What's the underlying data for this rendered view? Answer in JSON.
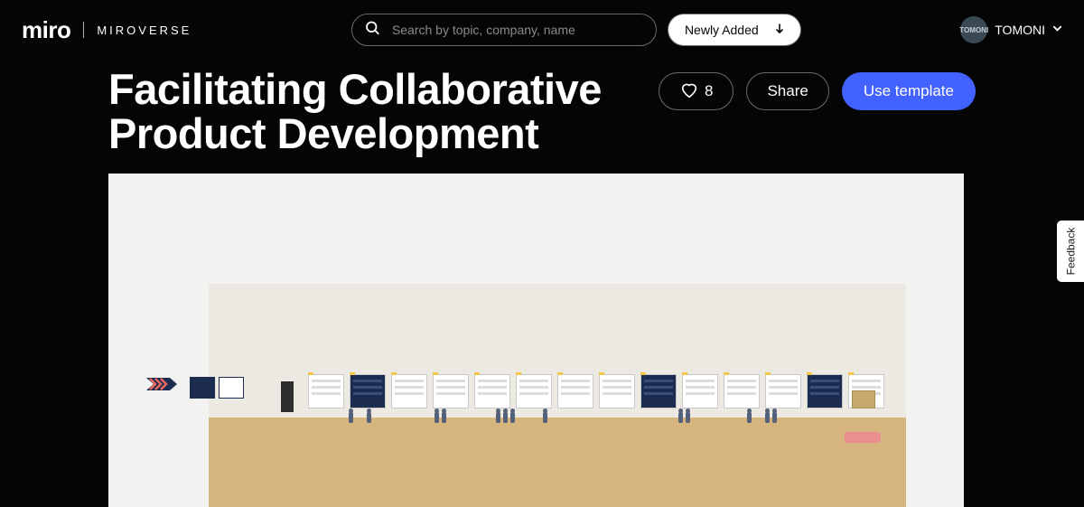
{
  "brand": {
    "logo": "miro",
    "sub": "MIROVERSE"
  },
  "search": {
    "placeholder": "Search by topic, company, name"
  },
  "sort": {
    "label": "Newly Added"
  },
  "user": {
    "name": "TOMONI",
    "avatar_text": "TOMONI"
  },
  "page": {
    "title": "Facilitating Collaborative Product Development"
  },
  "actions": {
    "like_count": "8",
    "share_label": "Share",
    "cta_label": "Use template"
  },
  "feedback": {
    "label": "Feedback"
  }
}
